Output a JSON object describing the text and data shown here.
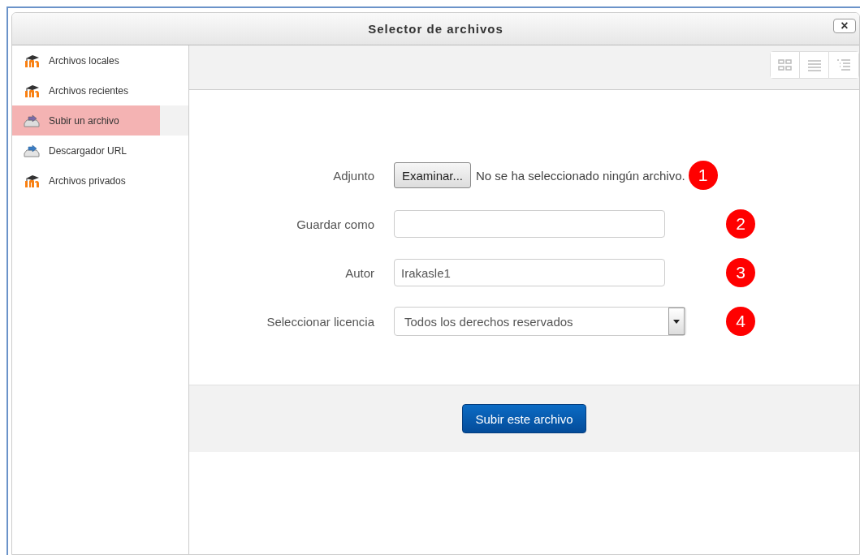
{
  "window": {
    "title": "Selector de archivos",
    "close_label": "×"
  },
  "sidebar": {
    "items": [
      {
        "label": "Archivos locales",
        "kind": "repository",
        "selected": false
      },
      {
        "label": "Archivos recientes",
        "kind": "repository",
        "selected": false
      },
      {
        "label": "Subir un archivo",
        "kind": "upload",
        "selected": true
      },
      {
        "label": "Descargador URL",
        "kind": "download",
        "selected": false
      },
      {
        "label": "Archivos privados",
        "kind": "repository",
        "selected": false
      }
    ]
  },
  "toolbar": {
    "views": [
      {
        "kind": "icons",
        "selected": false
      },
      {
        "kind": "list",
        "selected": false
      },
      {
        "kind": "tree",
        "selected": false
      }
    ]
  },
  "form": {
    "fields": [
      {
        "label": "Adjunto",
        "kind": "file",
        "button": "Examinar...",
        "status": "No se ha seleccionado ningún archivo.",
        "marker": "1"
      },
      {
        "label": "Guardar como",
        "kind": "text",
        "marker": "2"
      },
      {
        "label": "Autor",
        "kind": "text",
        "value": "Irakasle1",
        "marker": "3"
      },
      {
        "label": "Seleccionar licencia",
        "kind": "select",
        "value": "Todos los derechos reservados",
        "marker": "4"
      }
    ]
  },
  "submit": "Subir este archivo"
}
